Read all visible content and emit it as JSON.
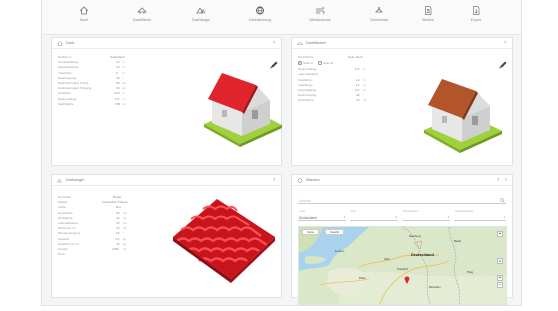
{
  "toolbar": {
    "items": [
      {
        "label": "Dach",
        "icon": "house-icon"
      },
      {
        "label": "Dachfläche",
        "icon": "roof-area-icon"
      },
      {
        "label": "Dachziegel",
        "icon": "roof-tile-icon"
      },
      {
        "label": "Dachdeckung",
        "icon": "globe-icon"
      },
      {
        "label": "Windlastzone",
        "icon": "wind-icon"
      },
      {
        "label": "Schneelast",
        "icon": "snow-icon"
      },
      {
        "label": "Bericht",
        "icon": "document-icon"
      },
      {
        "label": "Export",
        "icon": "export-icon"
      }
    ]
  },
  "panel_roof": {
    "title": "Dach",
    "rows": [
      {
        "label": "Dachform",
        "value": "Satteldach",
        "unit": ""
      },
      {
        "label": "Gebäudelänge",
        "value": "12",
        "unit": "m"
      },
      {
        "label": "Gebäudebreite",
        "value": "10",
        "unit": "m"
      },
      {
        "label": "Traufhöhe",
        "value": "6",
        "unit": "m"
      },
      {
        "label": "Dachneigung",
        "value": "40",
        "unit": "°"
      },
      {
        "label": "Dachüberstand Traufe",
        "value": "50",
        "unit": "cm"
      },
      {
        "label": "Dachüberstand Ortgang",
        "value": "30",
        "unit": "cm"
      },
      {
        "label": "Firsthöhe",
        "value": "10.2",
        "unit": "m"
      },
      {
        "label": "Sparrenlänge",
        "value": "6.5",
        "unit": "m"
      },
      {
        "label": "Dachfläche",
        "value": "156",
        "unit": "m²"
      }
    ]
  },
  "panel_area": {
    "title": "Dachflächen",
    "rows": [
      {
        "label": "Dachfläche",
        "value": "Seite Nord",
        "unit": ""
      },
      {
        "label": "Sparrenlänge",
        "value": "6.5",
        "unit": "m"
      },
      {
        "label": "Lattenabstand",
        "value": "",
        "unit": ""
      },
      {
        "label": "Firstlänge",
        "value": "12",
        "unit": "m"
      },
      {
        "label": "Trauflänge",
        "value": "12",
        "unit": "m"
      },
      {
        "label": "Ortganglänge",
        "value": "6.5",
        "unit": "m"
      },
      {
        "label": "Dachneigung",
        "value": "40",
        "unit": "°"
      },
      {
        "label": "Dachfläche",
        "value": "78",
        "unit": "m²"
      }
    ],
    "radio_a": "Seite A",
    "radio_b": "Seite B"
  },
  "panel_tile": {
    "title": "Dachziegel",
    "rows": [
      {
        "label": "Hersteller",
        "value": "Braas",
        "unit": ""
      },
      {
        "label": "Modell",
        "value": "Frankfurter Pfanne",
        "unit": ""
      },
      {
        "label": "Farbe",
        "value": "Rot",
        "unit": ""
      },
      {
        "label": "Deckbreite",
        "value": "30",
        "unit": "cm"
      },
      {
        "label": "Decklänge",
        "value": "33",
        "unit": "cm"
      },
      {
        "label": "Lattenabstand",
        "value": "33",
        "unit": "cm"
      },
      {
        "label": "Stück pro m²",
        "value": "10",
        "unit": "St."
      },
      {
        "label": "Mindestneigung",
        "value": "22",
        "unit": "°"
      },
      {
        "label": "Gewicht",
        "value": "4.2",
        "unit": "kg"
      },
      {
        "label": "Gewicht pro m²",
        "value": "42",
        "unit": "kg"
      },
      {
        "label": "Anzahl",
        "value": "1560",
        "unit": "St."
      },
      {
        "label": "Preis",
        "value": "",
        "unit": ""
      }
    ]
  },
  "panel_map": {
    "title": "Standort",
    "address_hint": "Adresse",
    "fields": [
      {
        "hint": "Land",
        "value": "Deutschland"
      },
      {
        "hint": "PLZ",
        "value": ""
      },
      {
        "hint": "Windlastzone",
        "value": ""
      },
      {
        "hint": "Schneelastzone",
        "value": ""
      }
    ],
    "tab_map": "Karte",
    "tab_satellite": "Satellit",
    "zoom_in": "+",
    "zoom_out": "−",
    "places": {
      "country": "Deutschland",
      "c1": "Hamburg",
      "c2": "Berlin",
      "c3": "Köln",
      "c4": "Frankfurt",
      "c5": "Prag",
      "c6": "Paris",
      "c7": "London",
      "c8": "München"
    }
  },
  "colors": {
    "roof_red": "#e0242c",
    "roof_brown": "#b2552b",
    "wall": "#e4e4e4",
    "grass": "#9fd13a"
  }
}
